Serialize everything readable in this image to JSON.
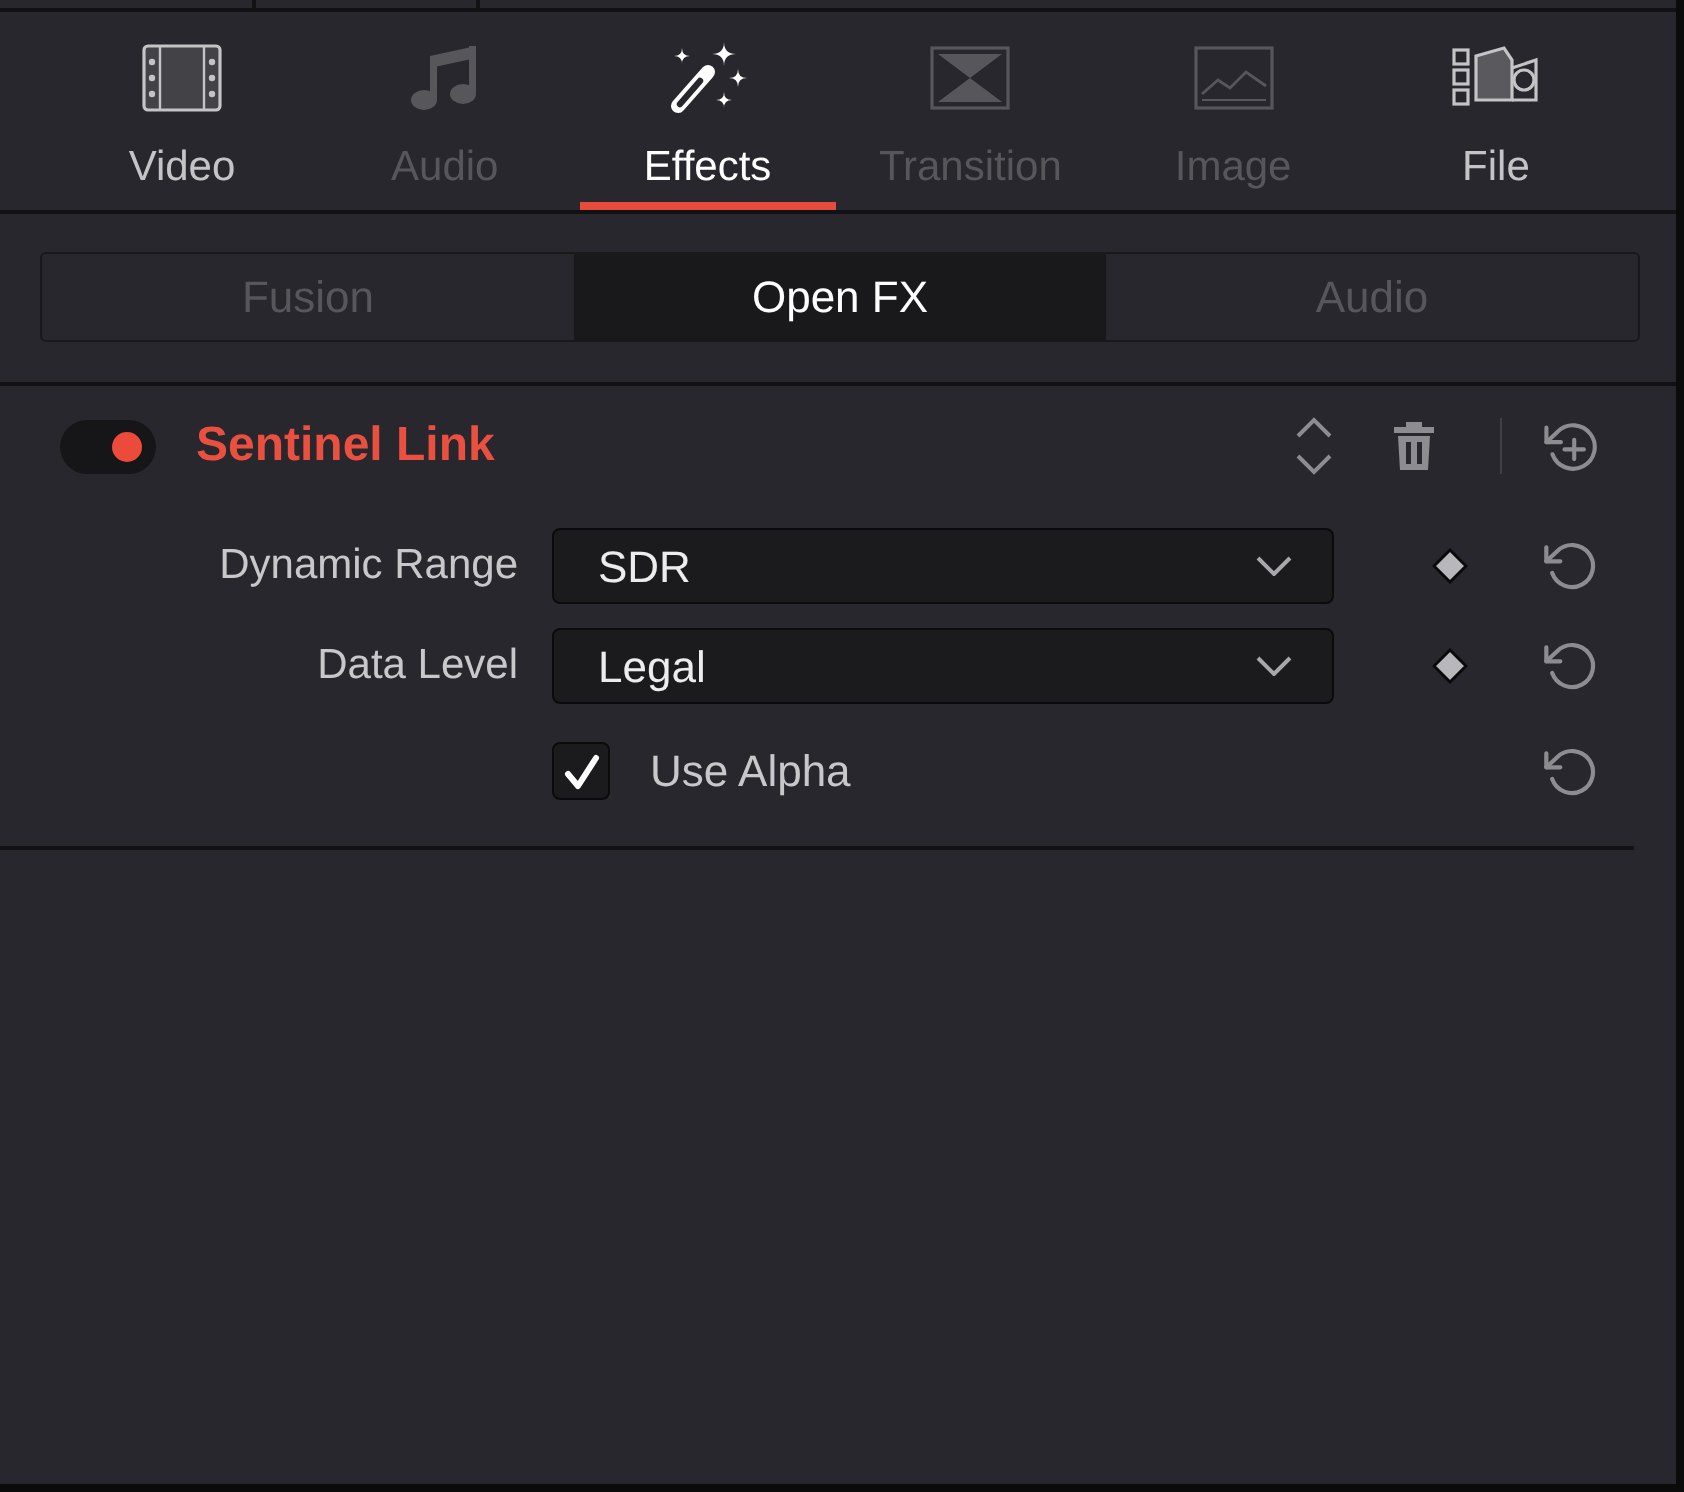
{
  "top_tabs": [
    {
      "kind": "video",
      "label": "Video",
      "selected": false,
      "disabled": false
    },
    {
      "kind": "audio",
      "label": "Audio",
      "selected": false,
      "disabled": true
    },
    {
      "kind": "effects",
      "label": "Effects",
      "selected": true,
      "disabled": false
    },
    {
      "kind": "transition",
      "label": "Transition",
      "selected": false,
      "disabled": true
    },
    {
      "kind": "image",
      "label": "Image",
      "selected": false,
      "disabled": true
    },
    {
      "kind": "file",
      "label": "File",
      "selected": false,
      "disabled": false
    }
  ],
  "sub_tabs": [
    {
      "label": "Fusion",
      "selected": false
    },
    {
      "label": "Open FX",
      "selected": true
    },
    {
      "label": "Audio",
      "selected": false
    }
  ],
  "effect": {
    "enabled": true,
    "title": "Sentinel Link",
    "parameters": [
      {
        "kind": "dropdown",
        "label": "Dynamic Range",
        "value": "SDR"
      },
      {
        "kind": "dropdown",
        "label": "Data Level",
        "value": "Legal"
      },
      {
        "kind": "checkbox",
        "label": "Use Alpha",
        "checked": true
      }
    ]
  }
}
